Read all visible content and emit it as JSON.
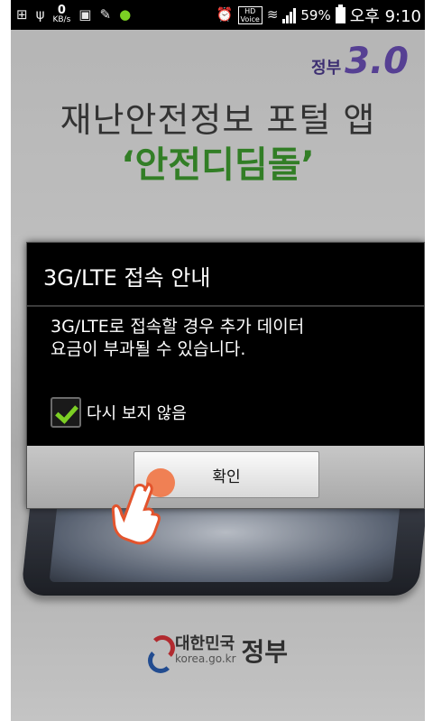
{
  "status_bar": {
    "download_speed_value": "0",
    "download_speed_unit": "KB/s",
    "hd_label": "HD",
    "voice_label": "Voice",
    "battery": "59%",
    "time": "오후 9:10"
  },
  "app": {
    "gov_logo_text": "정부",
    "gov_logo_number": "3.0",
    "title": "재난안전정보 포털 앱",
    "subtitle": "‘안전디딤돌’",
    "footer_logo_korean": "대한민국",
    "footer_logo_big": "정부",
    "footer_logo_url": "korea.go.kr"
  },
  "dialog": {
    "title": "3G/LTE 접속 안내",
    "message": "3G/LTE로 접속할 경우 추가 데이터\n요금이 부과될 수 있습니다.",
    "checkbox_label": "다시 보지 않음",
    "checkbox_checked": true,
    "ok_label": "확인"
  },
  "colors": {
    "accent_green": "#3d9a2f",
    "checkmark_green": "#7ccf24",
    "tap_indicator": "#f07a4c"
  }
}
